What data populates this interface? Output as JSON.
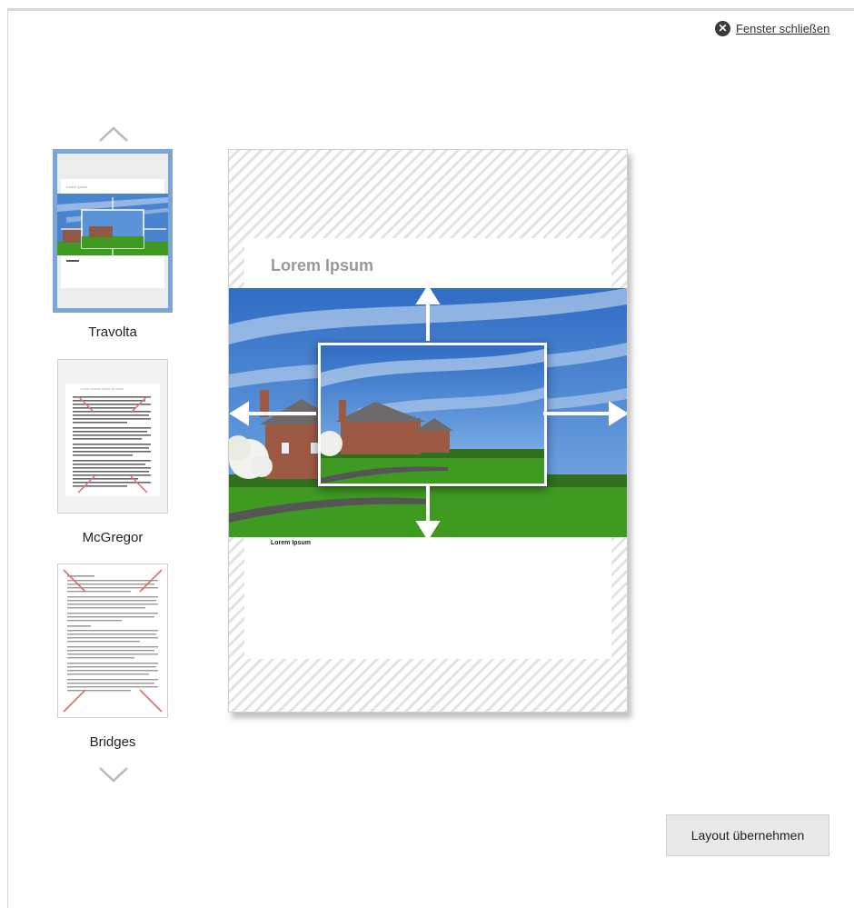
{
  "dialog": {
    "close_label": "Fenster schließen"
  },
  "layouts": [
    {
      "name": "Travolta",
      "selected": true
    },
    {
      "name": "McGregor",
      "selected": false
    },
    {
      "name": "Bridges",
      "selected": false
    }
  ],
  "preview": {
    "title": "Lorem Ipsum",
    "caption": "Lorem Ipsum"
  },
  "thumbs": {
    "travolta_title": "Lorem Ipsum",
    "mcgregor_title": "Lorem ipsum dolor sit amet"
  },
  "actions": {
    "apply_label": "Layout übernehmen"
  },
  "colors": {
    "selection_border": "#7aa6d6",
    "button_bg": "#e9e9e9",
    "sky": "#3d79c9",
    "grass": "#3f9a22"
  }
}
